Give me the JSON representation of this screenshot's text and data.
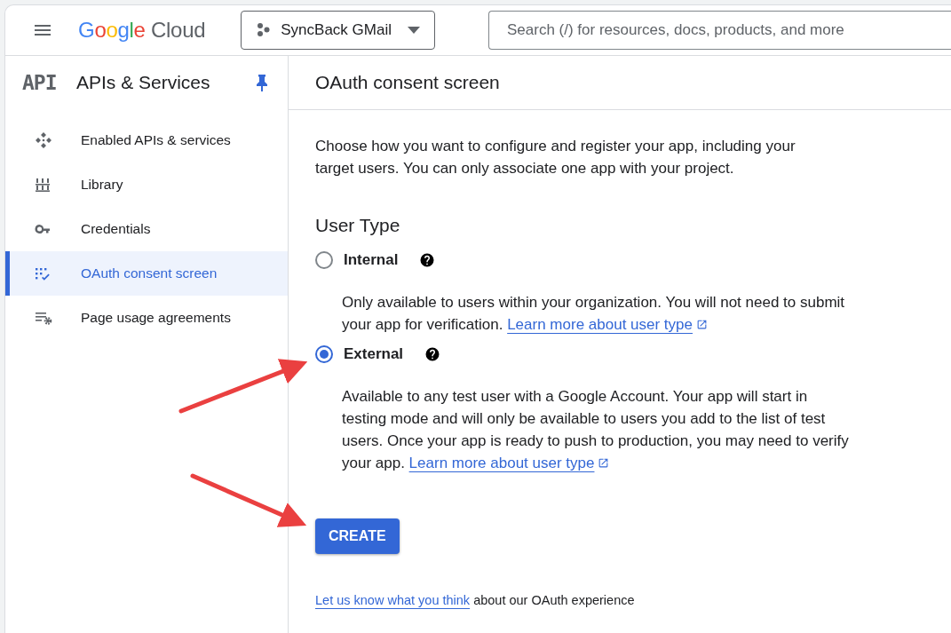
{
  "topbar": {
    "logo": {
      "brand": "Google",
      "product": "Cloud"
    },
    "project_picker": {
      "label": "SyncBack GMail"
    },
    "search": {
      "placeholder": "Search (/) for resources, docs, products, and more"
    }
  },
  "sidebar": {
    "badge": "API",
    "title": "APIs & Services",
    "items": [
      {
        "label": "Enabled APIs & services",
        "selected": false
      },
      {
        "label": "Library",
        "selected": false
      },
      {
        "label": "Credentials",
        "selected": false
      },
      {
        "label": "OAuth consent screen",
        "selected": true
      },
      {
        "label": "Page usage agreements",
        "selected": false
      }
    ]
  },
  "main": {
    "title": "OAuth consent screen",
    "intro": "Choose how you want to configure and register your app, including your target users. You can only associate one app with your project.",
    "section_title": "User Type",
    "options": [
      {
        "label": "Internal",
        "selected": false,
        "description": "Only available to users within your organization. You will not need to submit your app for verification.",
        "link": "Learn more about user type"
      },
      {
        "label": "External",
        "selected": true,
        "description": "Available to any test user with a Google Account. Your app will start in testing mode and will only be available to users you add to the list of test users. Once your app is ready to push to production, you may need to verify your app.",
        "link": "Learn more about user type"
      }
    ],
    "create_button": "CREATE",
    "feedback": {
      "link": "Let us know what you think",
      "text": "about our OAuth experience"
    }
  }
}
